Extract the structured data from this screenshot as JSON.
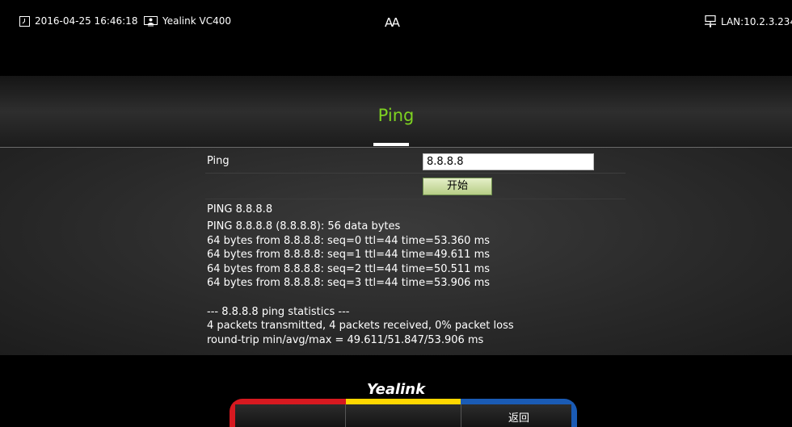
{
  "status_bar": {
    "datetime": "2016-04-25 16:46:18",
    "device_name": "Yealink VC400",
    "font_toggle": "AA",
    "network": "LAN:10.2.3.234"
  },
  "page": {
    "title": "Ping"
  },
  "form": {
    "ping_label": "Ping",
    "ip_value": "8.8.8.8",
    "start_label": "开始"
  },
  "output": {
    "heading": "PING 8.8.8.8",
    "lines": [
      "PING 8.8.8.8 (8.8.8.8): 56 data bytes",
      "64 bytes from 8.8.8.8: seq=0 ttl=44 time=53.360 ms",
      "64 bytes from 8.8.8.8: seq=1 ttl=44 time=49.611 ms",
      "64 bytes from 8.8.8.8: seq=2 ttl=44 time=50.511 ms",
      "64 bytes from 8.8.8.8: seq=3 ttl=44 time=53.906 ms",
      "",
      "--- 8.8.8.8 ping statistics ---",
      "4 packets transmitted, 4 packets received, 0% packet loss",
      "round-trip min/avg/max = 49.611/51.847/53.906 ms"
    ]
  },
  "brand": {
    "logo_text": "Yealink"
  },
  "remote_bar": {
    "back_label": "返回",
    "colors": {
      "red": "#d71920",
      "yellow": "#ffd700",
      "blue": "#1a5bb5"
    }
  },
  "colors": {
    "title_accent": "#7ed321"
  }
}
